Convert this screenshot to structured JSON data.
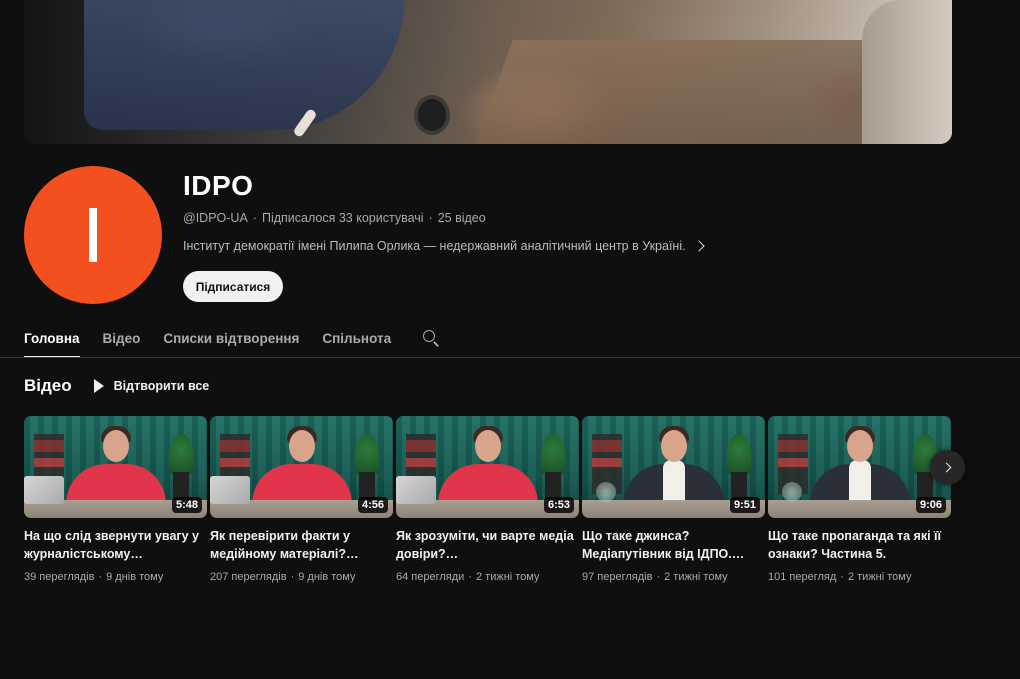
{
  "channel": {
    "name": "IDPO",
    "avatar_letter": "I",
    "avatar_color": "#f4501f",
    "handle": "@IDPO-UA",
    "subscribers": "Підписалося 33 користувачі",
    "video_count": "25 відео",
    "separator": "·",
    "description": "Інститут демократії імені Пилипа Орлика — недержавний аналітичний центр в Україні.",
    "subscribe_label": "Підписатися"
  },
  "tabs": [
    {
      "label": "Головна",
      "active": true
    },
    {
      "label": "Відео",
      "active": false
    },
    {
      "label": "Списки відтворення",
      "active": false
    },
    {
      "label": "Спільнота",
      "active": false
    }
  ],
  "section": {
    "title": "Відео",
    "play_all_label": "Відтворити все"
  },
  "videos": [
    {
      "title": "На що слід звернути увагу у журналістському…",
      "duration": "5:48",
      "views": "39 переглядів",
      "age": "9 днів тому",
      "style": "red"
    },
    {
      "title": "Як перевірити факти у медійному матеріалі?…",
      "duration": "4:56",
      "views": "207 переглядів",
      "age": "9 днів тому",
      "style": "red"
    },
    {
      "title": "Як зрозуміти, чи варте медіа довіри?…",
      "duration": "6:53",
      "views": "64 перегляди",
      "age": "2 тижні тому",
      "style": "red"
    },
    {
      "title": "Що таке джинса? Медіапутівник від ІДПО.…",
      "duration": "9:51",
      "views": "97 переглядів",
      "age": "2 тижні тому",
      "style": "dark"
    },
    {
      "title": "Що таке пропаганда та які її ознаки? Частина 5.",
      "duration": "9:06",
      "views": "101 перегляд",
      "age": "2 тижні тому",
      "style": "dark"
    }
  ],
  "icons": {
    "search": "search-icon",
    "play": "play-icon",
    "next": "chevron-right-icon"
  }
}
